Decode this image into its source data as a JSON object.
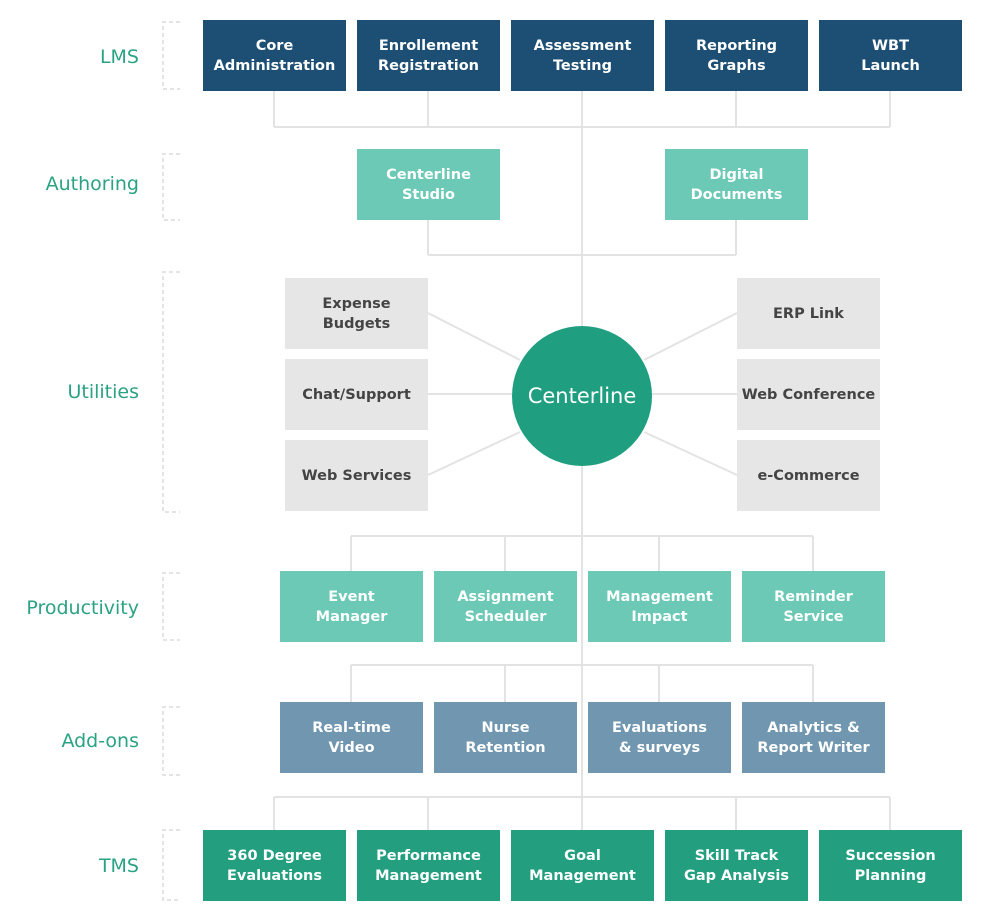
{
  "colors": {
    "lms": "#1d4e73",
    "authoring": "#6cc9b5",
    "utilities": "#e6e6e6",
    "hub": "#1f9e80",
    "productivity": "#6cc9b5",
    "addons": "#7096b0",
    "tms": "#239f80",
    "label": "#2aa283"
  },
  "hub": {
    "label": "Centerline"
  },
  "rows": {
    "lms": {
      "label": "LMS",
      "items": [
        "Core\nAdministration",
        "Enrollement\nRegistration",
        "Assessment\nTesting",
        "Reporting\nGraphs",
        "WBT\nLaunch"
      ]
    },
    "authoring": {
      "label": "Authoring",
      "items": [
        "Centerline\nStudio",
        "Digital\nDocuments"
      ]
    },
    "utilities": {
      "label": "Utilities",
      "left": [
        "Expense\nBudgets",
        "Chat/Support",
        "Web Services"
      ],
      "right": [
        "ERP Link",
        "Web Conference",
        "e-Commerce"
      ]
    },
    "productivity": {
      "label": "Productivity",
      "items": [
        "Event\nManager",
        "Assignment\nScheduler",
        "Management\nImpact",
        "Reminder\nService"
      ]
    },
    "addons": {
      "label": "Add-ons",
      "items": [
        "Real-time\nVideo",
        "Nurse\nRetention",
        "Evaluations\n& surveys",
        "Analytics &\nReport Writer"
      ]
    },
    "tms": {
      "label": "TMS",
      "items": [
        "360 Degree\nEvaluations",
        "Performance\nManagement",
        "Goal\nManagement",
        "Skill Track\nGap Analysis",
        "Succession\nPlanning"
      ]
    }
  }
}
